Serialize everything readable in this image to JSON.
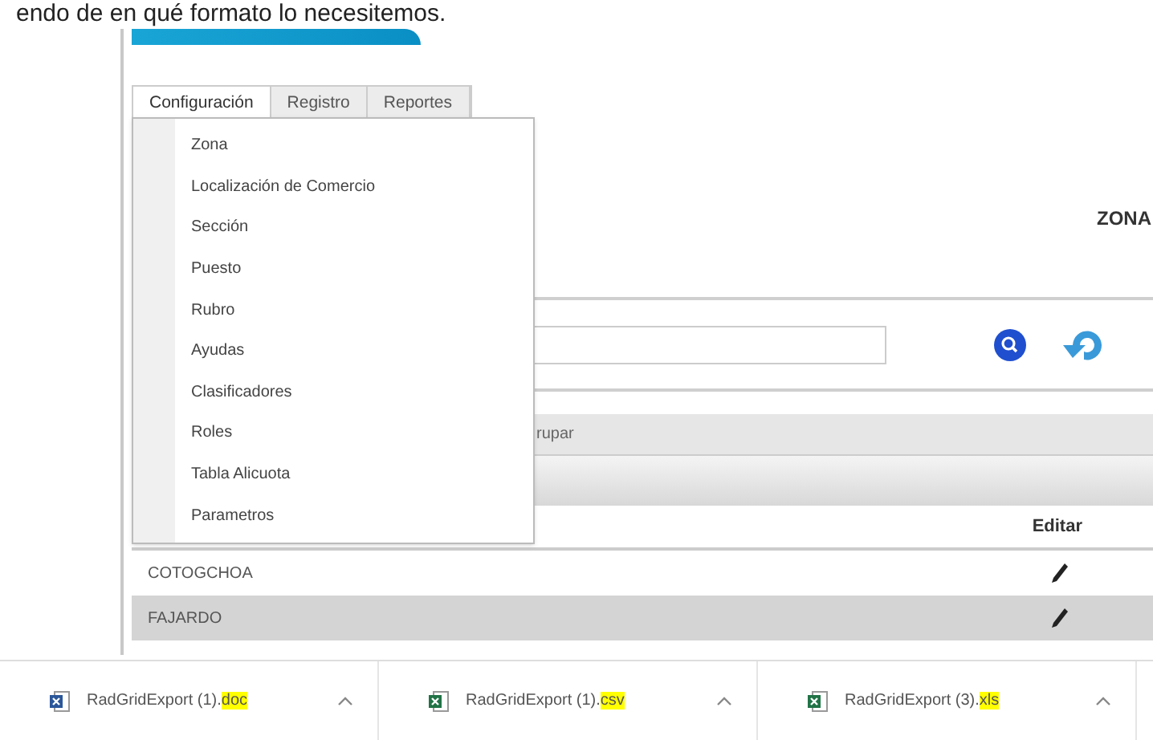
{
  "document_text": "endo de en qué formato lo necesitemos.",
  "tabs": [
    {
      "label": "Configuración",
      "selected": true
    },
    {
      "label": "Registro",
      "selected": false
    },
    {
      "label": "Reportes",
      "selected": false
    }
  ],
  "menu": {
    "items": [
      "Zona",
      "Localización de Comercio",
      "Sección",
      "Puesto",
      "Rubro",
      "Ayudas",
      "Clasificadores",
      "Roles",
      "Tabla Alicuota",
      "Parametros"
    ]
  },
  "page_title": "ZONA",
  "group_panel": {
    "text": "rupar"
  },
  "grid": {
    "columns": [
      "Editar"
    ],
    "rows": [
      {
        "name": "COTOGCHOA",
        "selected": false
      },
      {
        "name": "FAJARDO",
        "selected": true
      }
    ]
  },
  "downloads": [
    {
      "kind": "doc",
      "name": "RadGridExport (1).",
      "ext": "doc",
      "highlighted": true
    },
    {
      "kind": "csv",
      "name": "RadGridExport (1).",
      "ext": "csv",
      "highlighted": true
    },
    {
      "kind": "xls",
      "name": "RadGridExport (3).",
      "ext": "xls",
      "highlighted": true
    }
  ]
}
